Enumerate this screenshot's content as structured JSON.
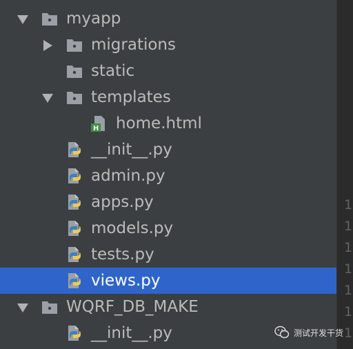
{
  "tree": {
    "rows": [
      {
        "label": "myapp",
        "type": "folder",
        "depth": 0,
        "expanded": true
      },
      {
        "label": "migrations",
        "type": "folder",
        "depth": 1,
        "expanded": false
      },
      {
        "label": "static",
        "type": "folder",
        "depth": 1
      },
      {
        "label": "templates",
        "type": "folder",
        "depth": 1,
        "expanded": true
      },
      {
        "label": "home.html",
        "type": "html-file",
        "depth": 2
      },
      {
        "label": "__init__.py",
        "type": "python-file",
        "depth": 1
      },
      {
        "label": "admin.py",
        "type": "python-file",
        "depth": 1
      },
      {
        "label": "apps.py",
        "type": "python-file",
        "depth": 1
      },
      {
        "label": "models.py",
        "type": "python-file",
        "depth": 1
      },
      {
        "label": "tests.py",
        "type": "python-file",
        "depth": 1
      },
      {
        "label": "views.py",
        "type": "python-file",
        "depth": 1,
        "selected": true
      },
      {
        "label": "WQRF_DB_MAKE",
        "type": "folder",
        "depth": 0,
        "expanded": true
      },
      {
        "label": "__init__.py",
        "type": "python-file",
        "depth": 1
      }
    ]
  },
  "gutter": {
    "numbers": [
      "1",
      "1",
      "1",
      "1",
      "1",
      "1",
      "1",
      "1"
    ]
  },
  "watermark": {
    "text": "测试开发干货"
  },
  "colors": {
    "panel_bg": "#3c3f41",
    "selection": "#2f65ca",
    "text": "#bbbbbb",
    "editor_bg": "#2b2b2b",
    "python_blue": "#3f7fbf",
    "python_yellow": "#f2c94c",
    "html_green": "#3e8e41"
  }
}
